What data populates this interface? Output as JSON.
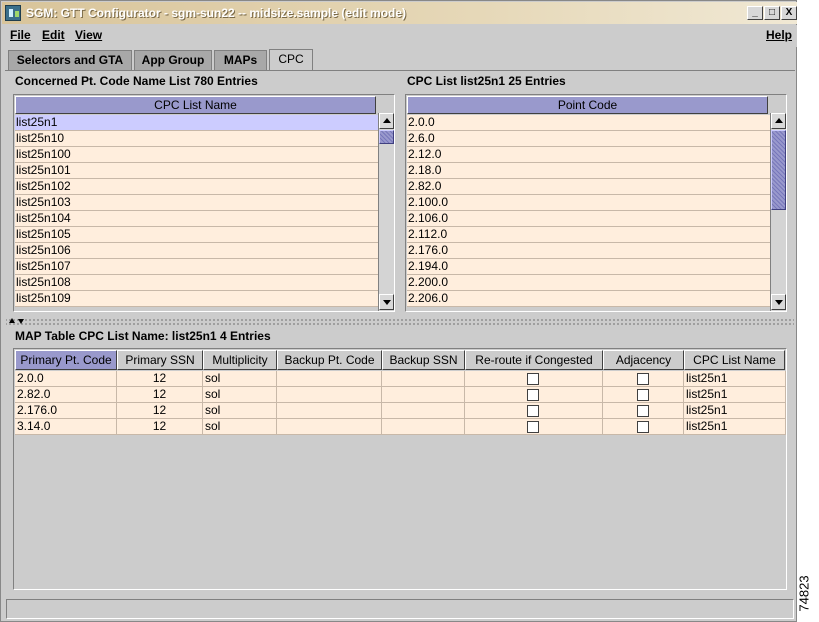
{
  "window": {
    "title": "SGM:  GTT Configurator - sgm-sun22 -- midsize.sample (edit mode)",
    "minimize": "_",
    "maximize": "□",
    "close": "X"
  },
  "menu": {
    "file": "File",
    "edit": "Edit",
    "view": "View",
    "help": "Help"
  },
  "tabs": [
    {
      "label": "Selectors and GTA",
      "active": false
    },
    {
      "label": "App Group",
      "active": false
    },
    {
      "label": "MAPs",
      "active": false
    },
    {
      "label": "CPC",
      "active": true
    }
  ],
  "cpc_names": {
    "title": "Concerned Pt. Code Name List   780 Entries",
    "column": "CPC List Name",
    "rows": [
      "list25n1",
      "list25n10",
      "list25n100",
      "list25n101",
      "list25n102",
      "list25n103",
      "list25n104",
      "list25n105",
      "list25n106",
      "list25n107",
      "list25n108",
      "list25n109"
    ],
    "selected_index": 0
  },
  "cpc_list": {
    "title": "CPC List  list25n1   25 Entries",
    "column": "Point Code",
    "rows": [
      "2.0.0",
      "2.6.0",
      "2.12.0",
      "2.18.0",
      "2.82.0",
      "2.100.0",
      "2.106.0",
      "2.112.0",
      "2.176.0",
      "2.194.0",
      "2.200.0",
      "2.206.0"
    ]
  },
  "map_table": {
    "title": "MAP Table  CPC List Name:  list25n1   4 Entries",
    "columns": [
      "Primary Pt. Code",
      "Primary SSN",
      "Multiplicity",
      "Backup Pt. Code",
      "Backup SSN",
      "Re-route if Congested",
      "Adjacency",
      "CPC List Name"
    ],
    "rows": [
      {
        "primary_pc": "2.0.0",
        "primary_ssn": "12",
        "multiplicity": "sol",
        "backup_pc": "",
        "backup_ssn": "",
        "reroute": false,
        "adjacency": false,
        "cpc_list_name": "list25n1"
      },
      {
        "primary_pc": "2.82.0",
        "primary_ssn": "12",
        "multiplicity": "sol",
        "backup_pc": "",
        "backup_ssn": "",
        "reroute": false,
        "adjacency": false,
        "cpc_list_name": "list25n1"
      },
      {
        "primary_pc": "2.176.0",
        "primary_ssn": "12",
        "multiplicity": "sol",
        "backup_pc": "",
        "backup_ssn": "",
        "reroute": false,
        "adjacency": false,
        "cpc_list_name": "list25n1"
      },
      {
        "primary_pc": "3.14.0",
        "primary_ssn": "12",
        "multiplicity": "sol",
        "backup_pc": "",
        "backup_ssn": "",
        "reroute": false,
        "adjacency": false,
        "cpc_list_name": "list25n1"
      }
    ]
  },
  "figure_id": "74823",
  "colors": {
    "header_blue": "#9999cc",
    "row_bg": "#ffeedd",
    "selected_row": "#ccccff",
    "panel_bg": "#cccccc"
  }
}
